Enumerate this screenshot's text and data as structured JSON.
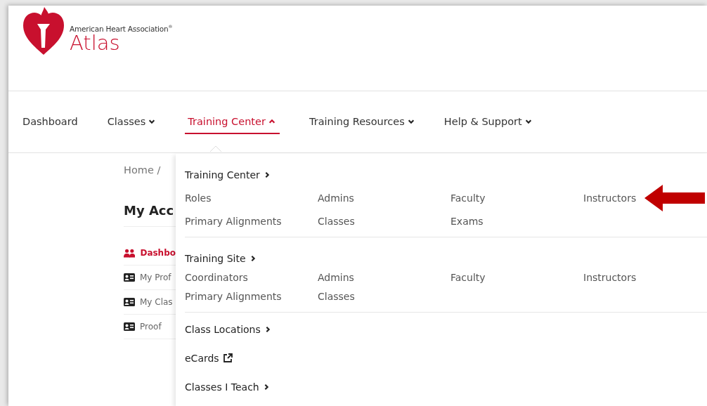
{
  "logo": {
    "org": "American Heart Association$^{®}$",
    "product": "Atlas"
  },
  "nav": [
    {
      "label": "Dashboard",
      "kind": "link",
      "selected": false
    },
    {
      "label": "Classes",
      "kind": "menu",
      "selected": false,
      "expanded": false
    },
    {
      "label": "Training Center",
      "kind": "menu",
      "selected": true,
      "expanded": true
    },
    {
      "label": "Training Resources",
      "kind": "menu",
      "selected": false,
      "expanded": false
    },
    {
      "label": "Help & Support",
      "kind": "menu",
      "selected": false,
      "expanded": false
    }
  ],
  "breadcrumb": "Home /",
  "page_title": "My Acc",
  "sidebar": {
    "items": [
      {
        "label": "Dashbo",
        "kind": "group",
        "selected": true
      },
      {
        "label": "My Prof",
        "kind": "card",
        "selected": false
      },
      {
        "label": "My Clas",
        "kind": "card",
        "selected": false
      },
      {
        "label": "Proof",
        "kind": "card",
        "selected": false
      }
    ]
  },
  "dropdown": {
    "sections": [
      {
        "title": "Training Center",
        "kind": "link",
        "items": [
          "Roles",
          "Admins",
          "Faculty",
          "Instructors",
          "Primary Alignments",
          "Classes",
          "Exams"
        ]
      },
      {
        "title": "Training Site",
        "kind": "link",
        "items": [
          "Coordinators",
          "Admins",
          "Faculty",
          "Instructors",
          "Primary Alignments",
          "Classes"
        ]
      },
      {
        "title": "Class Locations",
        "kind": "link"
      },
      {
        "title": "eCards",
        "kind": "external"
      },
      {
        "title": "Classes I Teach",
        "kind": "link"
      }
    ]
  }
}
